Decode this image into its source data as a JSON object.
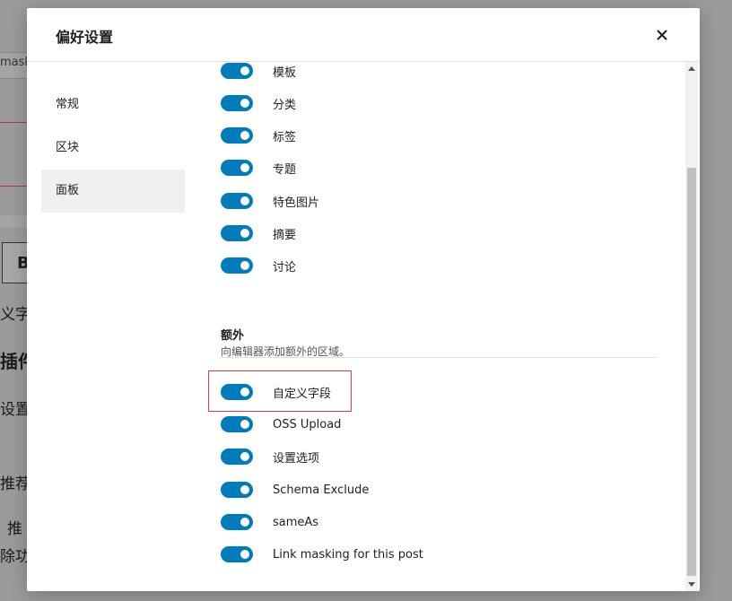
{
  "background": {
    "fragments": [
      "mask",
      "B",
      "义字段",
      "插件",
      "设置",
      "推荐",
      "推",
      "除功能"
    ]
  },
  "modal": {
    "title": "偏好设置",
    "close_icon": "close-icon"
  },
  "sidebar": {
    "items": [
      {
        "label": "常规",
        "active": false
      },
      {
        "label": "区块",
        "active": false
      },
      {
        "label": "面板",
        "active": true
      }
    ]
  },
  "panels": {
    "items": [
      {
        "label": "模板",
        "enabled": true
      },
      {
        "label": "分类",
        "enabled": true
      },
      {
        "label": "标签",
        "enabled": true
      },
      {
        "label": "专题",
        "enabled": true
      },
      {
        "label": "特色图片",
        "enabled": true
      },
      {
        "label": "摘要",
        "enabled": true
      },
      {
        "label": "讨论",
        "enabled": true
      }
    ]
  },
  "extra": {
    "title": "额外",
    "description": "向编辑器添加额外的区域。",
    "items": [
      {
        "label": "自定义字段",
        "enabled": true,
        "highlighted": true
      },
      {
        "label": "OSS Upload",
        "enabled": true
      },
      {
        "label": "设置选项",
        "enabled": true
      },
      {
        "label": "Schema Exclude",
        "enabled": true
      },
      {
        "label": "sameAs",
        "enabled": true
      },
      {
        "label": "Link masking for this post",
        "enabled": true
      }
    ]
  },
  "colors": {
    "toggle_on": "#007cba",
    "highlight_border": "#e53935",
    "overlay": "#8c8c8c"
  }
}
